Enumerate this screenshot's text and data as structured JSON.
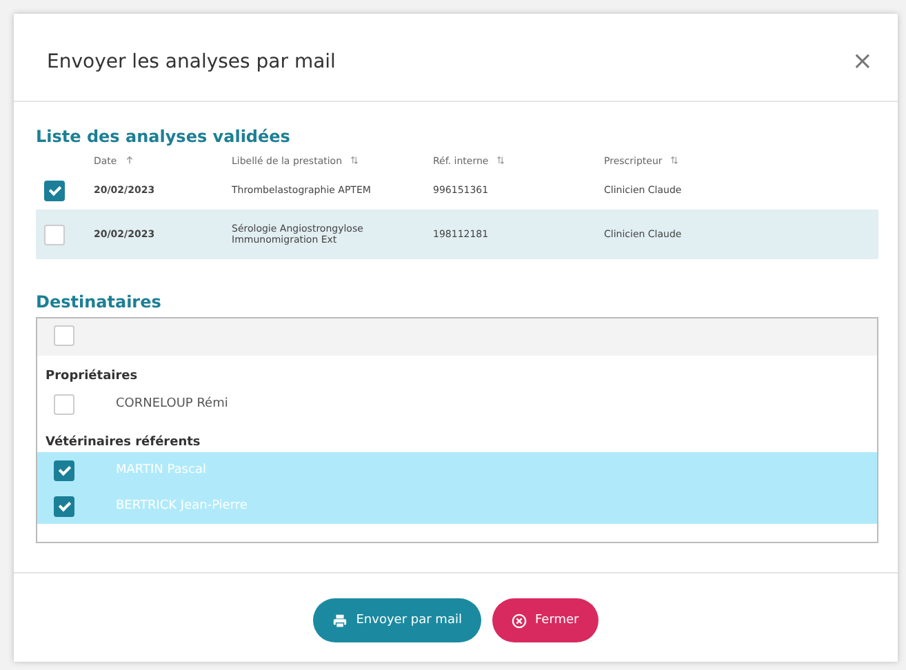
{
  "dialog": {
    "title": "Envoyer les analyses par mail",
    "close": "×"
  },
  "analyses": {
    "title": "Liste des analyses validées",
    "columns": [
      {
        "label": "Date",
        "sorted": true
      },
      {
        "label": "Libellé de la prestation",
        "sorted": false
      },
      {
        "label": "Réf. interne",
        "sorted": false
      },
      {
        "label": "Prescripteur",
        "sorted": false
      }
    ],
    "rows": [
      {
        "checked": true,
        "selected": false,
        "cells": [
          "20/02/2023",
          "Thrombelastographie APTEM",
          "996151361",
          "Clinicien Claude"
        ]
      },
      {
        "checked": false,
        "selected": true,
        "cells": [
          "20/02/2023",
          "Sérologie Angiostrongylose Immunomigration Ext",
          "198112181",
          "Clinicien Claude"
        ]
      }
    ]
  },
  "recipients": {
    "title": "Destinataires",
    "select_all": {
      "checked": false
    },
    "groups": [
      {
        "label": "Propriétaires",
        "items": [
          {
            "name": "CORNELOUP Rémi",
            "checked": false,
            "selected": false
          }
        ]
      },
      {
        "label": "Vétérinaires référents",
        "items": [
          {
            "name": "MARTIN Pascal",
            "checked": true,
            "selected": true
          },
          {
            "name": "BERTRICK Jean-Pierre",
            "checked": true,
            "selected": true
          }
        ]
      }
    ]
  },
  "buttons": [
    {
      "kind": "send",
      "label": "Envoyer par mail"
    },
    {
      "kind": "close",
      "label": "Fermer"
    }
  ]
}
